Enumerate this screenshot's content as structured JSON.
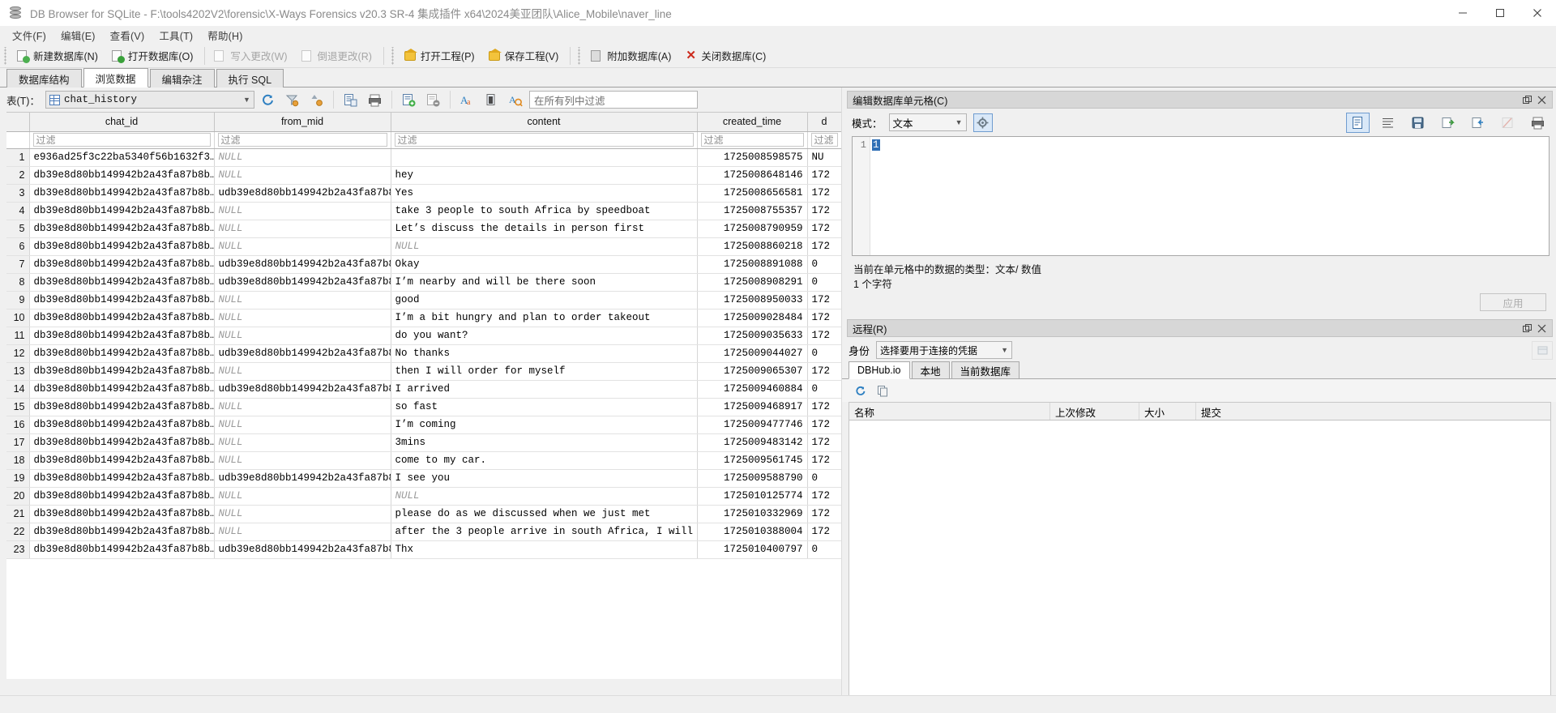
{
  "window": {
    "title": "DB Browser for SQLite - F:\\tools4202V2\\forensic\\X-Ways Forensics v20.3 SR-4 集成插件 x64\\2024美亚团队\\Alice_Mobile\\naver_line",
    "app_icon": "database-icon",
    "minimize_label": "最小化",
    "maximize_label": "最大化",
    "close_label": "关闭"
  },
  "menubar": {
    "items": [
      {
        "label": "文件(F)",
        "name": "menu-file"
      },
      {
        "label": "编辑(E)",
        "name": "menu-edit"
      },
      {
        "label": "查看(V)",
        "name": "menu-view"
      },
      {
        "label": "工具(T)",
        "name": "menu-tools"
      },
      {
        "label": "帮助(H)",
        "name": "menu-help"
      }
    ]
  },
  "toolbar": {
    "new_db": "新建数据库(N)",
    "open_db": "打开数据库(O)",
    "write_changes": "写入更改(W)",
    "revert_changes": "倒退更改(R)",
    "open_project": "打开工程(P)",
    "save_project": "保存工程(V)",
    "attach_db": "附加数据库(A)",
    "close_db": "关闭数据库(C)"
  },
  "tabs": [
    {
      "label": "数据库结构",
      "active": false,
      "name": "tab-database-structure"
    },
    {
      "label": "浏览数据",
      "active": true,
      "name": "tab-browse-data"
    },
    {
      "label": "编辑杂注",
      "active": false,
      "name": "tab-edit-pragmas"
    },
    {
      "label": "执行 SQL",
      "active": false,
      "name": "tab-execute-sql"
    }
  ],
  "table_bar": {
    "label": "表(T)：",
    "selected_table": "chat_history",
    "filter_placeholder": "在所有列中过滤",
    "filter_value": "",
    "buttons": [
      {
        "name": "refresh-button",
        "title": "刷新"
      },
      {
        "name": "filter-button",
        "title": "过滤"
      },
      {
        "name": "sort-button",
        "title": "排序"
      },
      {
        "name": "new-record-button",
        "title": "新建记录"
      },
      {
        "name": "print-button",
        "title": "打印"
      },
      {
        "name": "insert-record-button",
        "title": "插入记录"
      },
      {
        "name": "delete-record-button",
        "title": "删除记录"
      },
      {
        "name": "font-button",
        "title": "字体"
      },
      {
        "name": "conditional-format-button",
        "title": "条件格式"
      },
      {
        "name": "find-replace-button",
        "title": "查找替换"
      }
    ]
  },
  "grid": {
    "columns": [
      "chat_id",
      "from_mid",
      "content",
      "created_time",
      "d"
    ],
    "filter_row_placeholder": "过滤",
    "rows": [
      {
        "n": "1",
        "chat_id": "e936ad25f3c22ba5340f56b1632f3…",
        "from_mid": "NULL",
        "content": "",
        "created_time": "1725008598575",
        "d": "NU"
      },
      {
        "n": "2",
        "chat_id": "db39e8d80bb149942b2a43fa87b8b…",
        "from_mid": "NULL",
        "content": "hey",
        "created_time": "1725008648146",
        "d": "172"
      },
      {
        "n": "3",
        "chat_id": "db39e8d80bb149942b2a43fa87b8b…",
        "from_mid": "udb39e8d80bb149942b2a43fa87b8b…",
        "content": "Yes",
        "created_time": "1725008656581",
        "d": "172"
      },
      {
        "n": "4",
        "chat_id": "db39e8d80bb149942b2a43fa87b8b…",
        "from_mid": "NULL",
        "content": "take 3 people to south Africa by speedboat",
        "created_time": "1725008755357",
        "d": "172",
        "highlight": true
      },
      {
        "n": "5",
        "chat_id": "db39e8d80bb149942b2a43fa87b8b…",
        "from_mid": "NULL",
        "content": "Let’s discuss the details in person first",
        "created_time": "1725008790959",
        "d": "172"
      },
      {
        "n": "6",
        "chat_id": "db39e8d80bb149942b2a43fa87b8b…",
        "from_mid": "NULL",
        "content": "NULL",
        "created_time": "1725008860218",
        "d": "172"
      },
      {
        "n": "7",
        "chat_id": "db39e8d80bb149942b2a43fa87b8b…",
        "from_mid": "udb39e8d80bb149942b2a43fa87b8b…",
        "content": "Okay",
        "created_time": "1725008891088",
        "d": "0"
      },
      {
        "n": "8",
        "chat_id": "db39e8d80bb149942b2a43fa87b8b…",
        "from_mid": "udb39e8d80bb149942b2a43fa87b8b…",
        "content": "I’m nearby and will be there soon",
        "created_time": "1725008908291",
        "d": "0"
      },
      {
        "n": "9",
        "chat_id": "db39e8d80bb149942b2a43fa87b8b…",
        "from_mid": "NULL",
        "content": "good",
        "created_time": "1725008950033",
        "d": "172"
      },
      {
        "n": "10",
        "chat_id": "db39e8d80bb149942b2a43fa87b8b…",
        "from_mid": "NULL",
        "content": "I’m a bit hungry and plan to order takeout",
        "created_time": "1725009028484",
        "d": "172"
      },
      {
        "n": "11",
        "chat_id": "db39e8d80bb149942b2a43fa87b8b…",
        "from_mid": "NULL",
        "content": "do you want?",
        "created_time": "1725009035633",
        "d": "172"
      },
      {
        "n": "12",
        "chat_id": "db39e8d80bb149942b2a43fa87b8b…",
        "from_mid": "udb39e8d80bb149942b2a43fa87b8b…",
        "content": "No thanks",
        "created_time": "1725009044027",
        "d": "0"
      },
      {
        "n": "13",
        "chat_id": "db39e8d80bb149942b2a43fa87b8b…",
        "from_mid": "NULL",
        "content": "then I will order for myself",
        "created_time": "1725009065307",
        "d": "172"
      },
      {
        "n": "14",
        "chat_id": "db39e8d80bb149942b2a43fa87b8b…",
        "from_mid": "udb39e8d80bb149942b2a43fa87b8b…",
        "content": "I arrived",
        "created_time": "1725009460884",
        "d": "0"
      },
      {
        "n": "15",
        "chat_id": "db39e8d80bb149942b2a43fa87b8b…",
        "from_mid": "NULL",
        "content": "so fast",
        "created_time": "1725009468917",
        "d": "172"
      },
      {
        "n": "16",
        "chat_id": "db39e8d80bb149942b2a43fa87b8b…",
        "from_mid": "NULL",
        "content": "I’m coming",
        "created_time": "1725009477746",
        "d": "172"
      },
      {
        "n": "17",
        "chat_id": "db39e8d80bb149942b2a43fa87b8b…",
        "from_mid": "NULL",
        "content": "3mins",
        "created_time": "1725009483142",
        "d": "172"
      },
      {
        "n": "18",
        "chat_id": "db39e8d80bb149942b2a43fa87b8b…",
        "from_mid": "NULL",
        "content": "come to my car.",
        "created_time": "1725009561745",
        "d": "172"
      },
      {
        "n": "19",
        "chat_id": "db39e8d80bb149942b2a43fa87b8b…",
        "from_mid": "udb39e8d80bb149942b2a43fa87b8b…",
        "content": "I see you",
        "created_time": "1725009588790",
        "d": "0"
      },
      {
        "n": "20",
        "chat_id": "db39e8d80bb149942b2a43fa87b8b…",
        "from_mid": "NULL",
        "content": "NULL",
        "created_time": "1725010125774",
        "d": "172"
      },
      {
        "n": "21",
        "chat_id": "db39e8d80bb149942b2a43fa87b8b…",
        "from_mid": "NULL",
        "content": "please do as we discussed when we just met",
        "created_time": "1725010332969",
        "d": "172"
      },
      {
        "n": "22",
        "chat_id": "db39e8d80bb149942b2a43fa87b8b…",
        "from_mid": "NULL",
        "content": "after the 3 people arrive in south Africa, I will …",
        "created_time": "1725010388004",
        "d": "172"
      },
      {
        "n": "23",
        "chat_id": "db39e8d80bb149942b2a43fa87b8b…",
        "from_mid": "udb39e8d80bb149942b2a43fa87b8b…",
        "content": "Thx",
        "created_time": "1725010400797",
        "d": "0"
      }
    ],
    "highlight_color": "#e02424"
  },
  "edit_cell_panel": {
    "title": "编辑数据库单元格(C)",
    "mode_label": "模式：",
    "mode_value": "文本",
    "editor_line_number": "1",
    "editor_content": "1",
    "type_info": "当前在单元格中的数据的类型：文本/ 数值",
    "char_count": "1 个字符",
    "apply_label": "应用",
    "toolbar_icons": [
      {
        "name": "text-mode-icon",
        "selected": true
      },
      {
        "name": "word-wrap-icon",
        "selected": false
      },
      {
        "name": "import-data-icon",
        "selected": false
      },
      {
        "name": "export-data-icon",
        "selected": false
      },
      {
        "name": "save-as-icon",
        "selected": false
      },
      {
        "name": "set-null-icon",
        "selected": false,
        "disabled": true
      },
      {
        "name": "print-cell-icon",
        "selected": false
      }
    ]
  },
  "remote_panel": {
    "title": "远程(R)",
    "identity_label": "身份",
    "identity_value": "选择要用于连接的凭据",
    "tabs": [
      {
        "label": "DBHub.io",
        "active": true,
        "name": "remote-tab-dbhub"
      },
      {
        "label": "本地",
        "active": false,
        "name": "remote-tab-local"
      },
      {
        "label": "当前数据库",
        "active": false,
        "name": "remote-tab-current-db"
      }
    ],
    "columns": [
      "名称",
      "上次修改",
      "大小",
      "提交"
    ],
    "rows": []
  }
}
